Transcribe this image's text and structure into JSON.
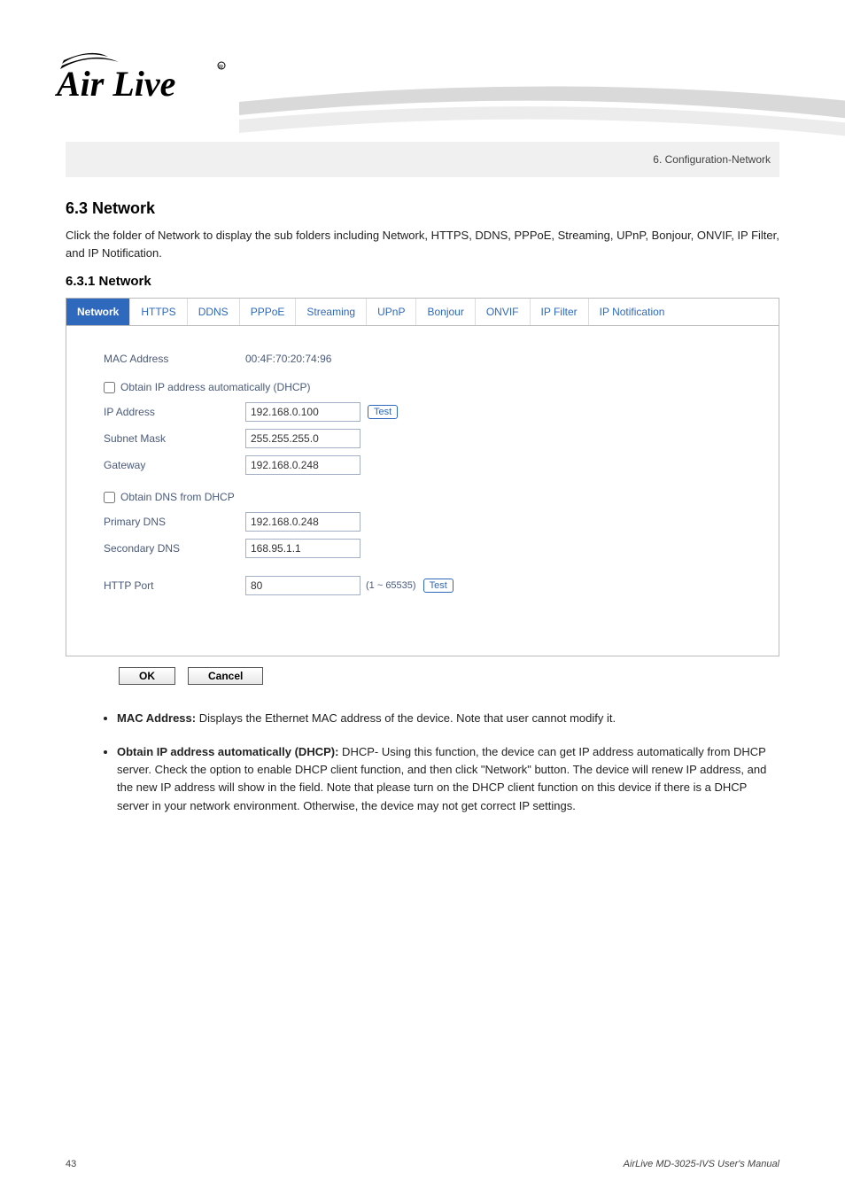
{
  "header": {
    "logo_text_1": "Air",
    "logo_text_2": "Live",
    "chapter_right": "6. Configuration-Network"
  },
  "section": {
    "heading": "6.3 Network",
    "description": "Click the folder of Network to display the sub folders including Network, HTTPS, DDNS, PPPoE, Streaming, UPnP, Bonjour, ONVIF, IP Filter, and IP Notification.",
    "subheading": "6.3.1 Network"
  },
  "tabs": [
    "Network",
    "HTTPS",
    "DDNS",
    "PPPoE",
    "Streaming",
    "UPnP",
    "Bonjour",
    "ONVIF",
    "IP Filter",
    "IP Notification"
  ],
  "form": {
    "mac_label": "MAC Address",
    "mac_value": "00:4F:70:20:74:96",
    "dhcp_checkbox_label": "Obtain IP address automatically (DHCP)",
    "ip_label": "IP Address",
    "ip_value": "192.168.0.100",
    "test_btn": "Test",
    "subnet_label": "Subnet Mask",
    "subnet_value": "255.255.255.0",
    "gateway_label": "Gateway",
    "gateway_value": "192.168.0.248",
    "dns_dhcp_checkbox_label": "Obtain DNS from DHCP",
    "primary_dns_label": "Primary DNS",
    "primary_dns_value": "192.168.0.248",
    "secondary_dns_label": "Secondary DNS",
    "secondary_dns_value": "168.95.1.1",
    "http_port_label": "HTTP Port",
    "http_port_value": "80",
    "http_port_range": "(1 ~ 65535)",
    "ok_btn": "OK",
    "cancel_btn": "Cancel"
  },
  "bullets": [
    {
      "term": "MAC Address:",
      "text": " Displays the Ethernet MAC address of the device. Note that user cannot modify it."
    },
    {
      "term": "Obtain IP address automatically (DHCP):",
      "text": " DHCP- Using this function, the device can get IP address automatically from DHCP server. Check the option to enable DHCP client function, and then click \"Network\" button. The device will renew IP address, and the new IP address will show in the field. Note that please turn on the DHCP client function on this device if there is a DHCP server in your network environment. Otherwise, the device may not get correct IP settings."
    }
  ],
  "footer": {
    "page": "43",
    "pub_line1": "AirLive MD-3025-IVS User's Manual"
  }
}
